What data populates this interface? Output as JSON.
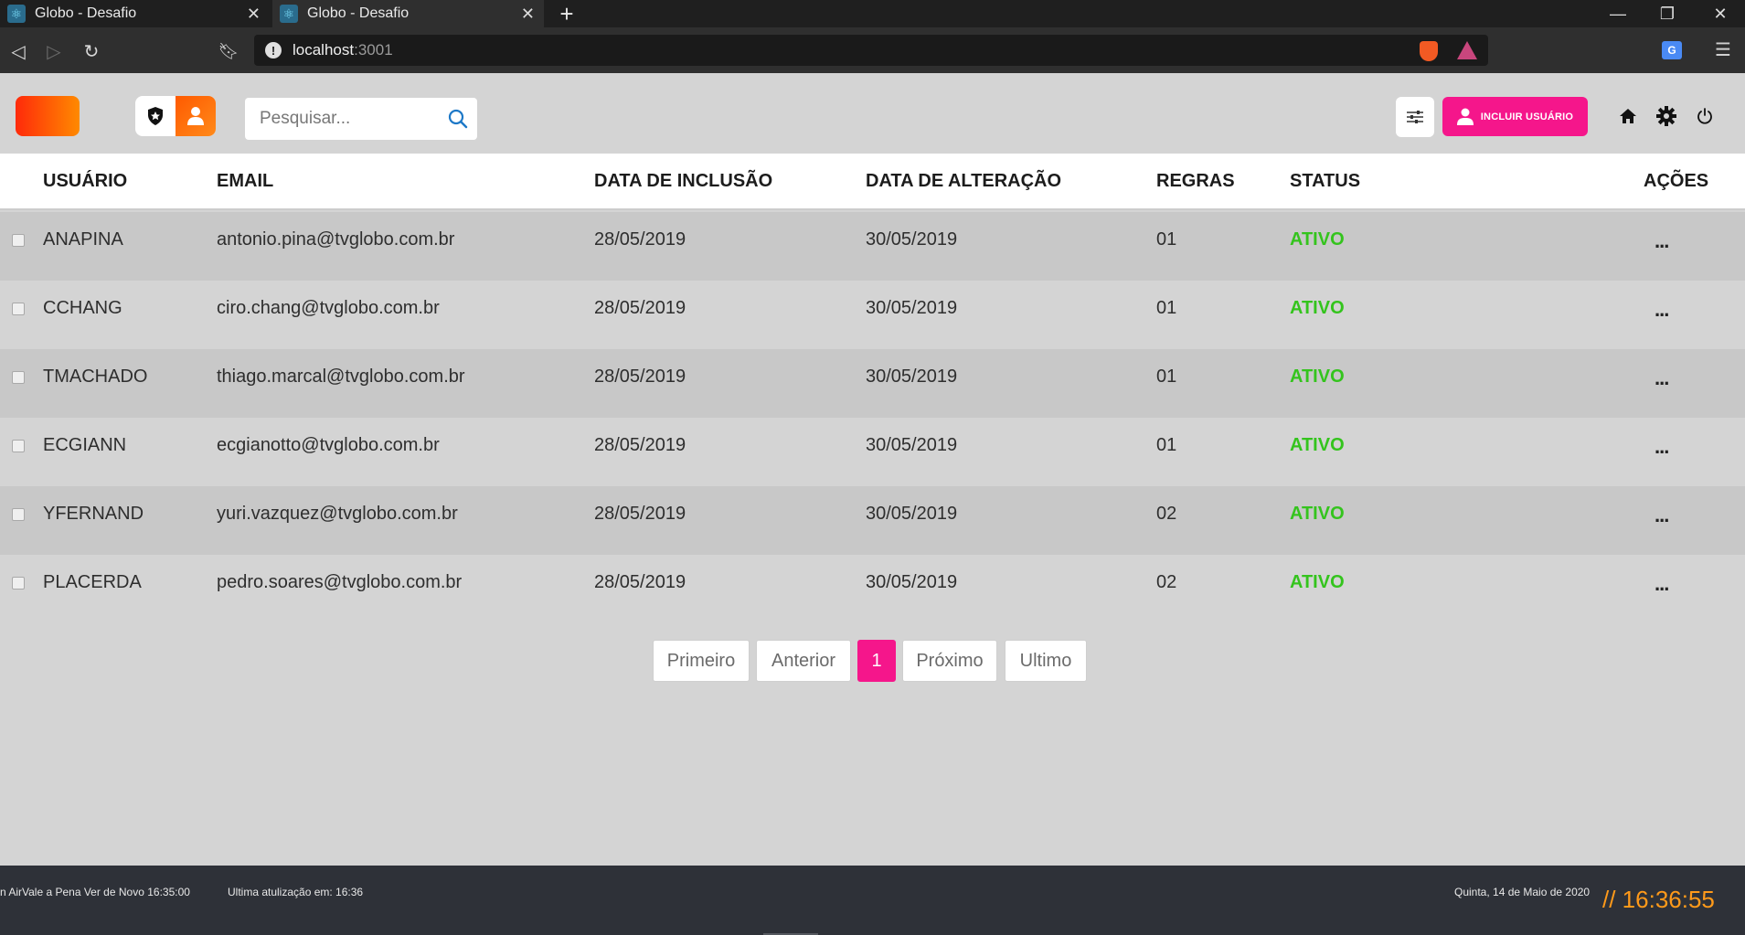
{
  "browser": {
    "tabs": [
      {
        "title": "Globo - Desafio"
      },
      {
        "title": "Globo - Desafio"
      }
    ],
    "url_host": "localhost",
    "url_port": ":3001"
  },
  "header": {
    "search": {
      "placeholder": "Pesquisar..."
    },
    "include_user_label": "INCLUIR USUÁRIO",
    "colors": {
      "accent": "#f5168b",
      "brand": "#ff5a00"
    }
  },
  "table": {
    "columns": [
      "USUÁRIO",
      "EMAIL",
      "DATA DE INCLUSÃO",
      "DATA DE ALTERAÇÃO",
      "REGRAS",
      "STATUS",
      "AÇÕES"
    ],
    "rows": [
      {
        "user": "ANAPINA",
        "email": "antonio.pina@tvglobo.com.br",
        "created": "28/05/2019",
        "modified": "30/05/2019",
        "rules": "01",
        "status": "ATIVO",
        "actions": "..."
      },
      {
        "user": "CCHANG",
        "email": "ciro.chang@tvglobo.com.br",
        "created": "28/05/2019",
        "modified": "30/05/2019",
        "rules": "01",
        "status": "ATIVO",
        "actions": "..."
      },
      {
        "user": "TMACHADO",
        "email": "thiago.marcal@tvglobo.com.br",
        "created": "28/05/2019",
        "modified": "30/05/2019",
        "rules": "01",
        "status": "ATIVO",
        "actions": "..."
      },
      {
        "user": "ECGIANN",
        "email": "ecgianotto@tvglobo.com.br",
        "created": "28/05/2019",
        "modified": "30/05/2019",
        "rules": "01",
        "status": "ATIVO",
        "actions": "..."
      },
      {
        "user": "YFERNAND",
        "email": "yuri.vazquez@tvglobo.com.br",
        "created": "28/05/2019",
        "modified": "30/05/2019",
        "rules": "02",
        "status": "ATIVO",
        "actions": "..."
      },
      {
        "user": "PLACERDA",
        "email": "pedro.soares@tvglobo.com.br",
        "created": "28/05/2019",
        "modified": "30/05/2019",
        "rules": "02",
        "status": "ATIVO",
        "actions": "..."
      }
    ],
    "status_color": "#34c41d"
  },
  "pagination": {
    "first": "Primeiro",
    "prev": "Anterior",
    "current": "1",
    "next": "Próximo",
    "last": "Ultimo"
  },
  "footer": {
    "ticker": "n AirVale a Pena Ver de Novo 16:35:00",
    "last_update": "Ultima atulização em: 16:36",
    "date": "Quinta, 14 de Maio de 2020",
    "clock": "// 16:36:55"
  }
}
